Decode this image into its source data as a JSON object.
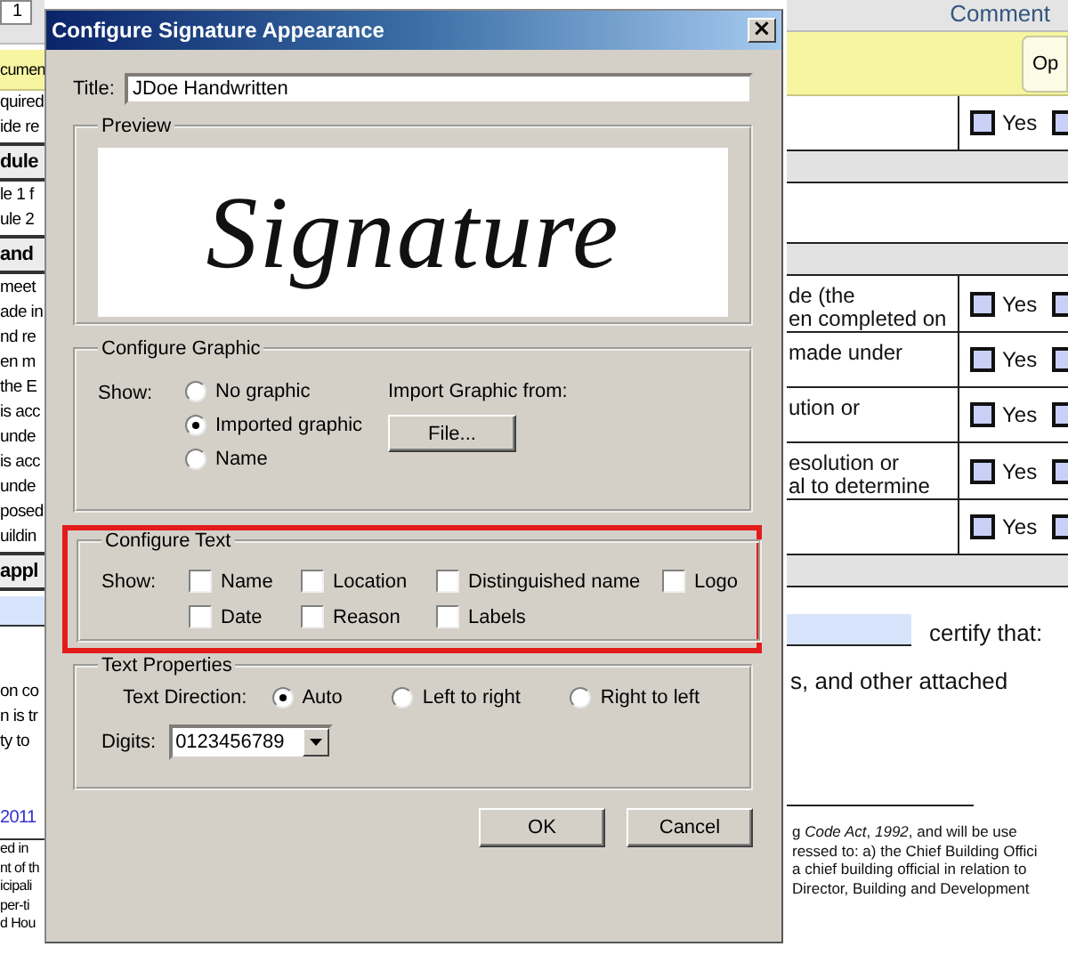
{
  "document": {
    "page_number": "1",
    "comment_tab": "Comment",
    "banner_text": "cumen",
    "banner_button": "Op",
    "left_lines": [
      {
        "kind": "text",
        "text": "quired"
      },
      {
        "kind": "text",
        "text": "ide re"
      },
      {
        "kind": "heading",
        "text": "dule"
      },
      {
        "kind": "text",
        "text": "le 1 f"
      },
      {
        "kind": "text",
        "text": "ule 2"
      },
      {
        "kind": "heading",
        "text": "and"
      },
      {
        "kind": "text",
        "text": "meet"
      },
      {
        "kind": "text",
        "text": "ade in"
      },
      {
        "kind": "text",
        "text": "nd re"
      },
      {
        "kind": "text",
        "text": "en m"
      },
      {
        "kind": "text",
        "text": "the E"
      },
      {
        "kind": "text",
        "text": "is acc"
      },
      {
        "kind": "text",
        "text": "unde"
      },
      {
        "kind": "text",
        "text": "is acc"
      },
      {
        "kind": "text",
        "text": "unde"
      },
      {
        "kind": "text",
        "text": "posed"
      },
      {
        "kind": "text",
        "text": "uildin"
      },
      {
        "kind": "heading",
        "text": "appl"
      },
      {
        "kind": "field"
      },
      {
        "kind": "text",
        "text": "on co"
      },
      {
        "kind": "text",
        "text": "n is tr"
      },
      {
        "kind": "text",
        "text": "ty to"
      },
      {
        "kind": "link",
        "text": "2011"
      },
      {
        "kind": "small",
        "text": "ed in"
      },
      {
        "kind": "small",
        "text": "nt of th"
      },
      {
        "kind": "small",
        "text": "icipali"
      },
      {
        "kind": "small",
        "text": "per-ti"
      },
      {
        "kind": "small",
        "text": "d Hou"
      }
    ],
    "right_rows": [
      {
        "kind": "row",
        "lines": [],
        "options": [
          {
            "label": "Yes",
            "checked": false
          },
          {
            "checked": false
          }
        ]
      },
      {
        "kind": "band"
      },
      {
        "kind": "blank"
      },
      {
        "kind": "band"
      },
      {
        "kind": "row",
        "lines": [
          "de (the",
          "en completed on"
        ],
        "options": [
          {
            "label": "Yes",
            "checked": false
          },
          {
            "checked": false
          }
        ]
      },
      {
        "kind": "row",
        "lines": [
          "made under"
        ],
        "options": [
          {
            "label": "Yes",
            "checked": false
          },
          {
            "checked": false
          }
        ]
      },
      {
        "kind": "row",
        "lines": [
          "ution or"
        ],
        "options": [
          {
            "label": "Yes",
            "checked": false
          },
          {
            "checked": false
          }
        ]
      },
      {
        "kind": "row",
        "lines": [
          "esolution or",
          "al to determine"
        ],
        "options": [
          {
            "label": "Yes",
            "checked": false
          },
          {
            "checked": false
          }
        ]
      },
      {
        "kind": "row",
        "lines": [],
        "options": [
          {
            "label": "Yes",
            "checked": false
          },
          {
            "checked": false
          }
        ]
      },
      {
        "kind": "band"
      },
      {
        "kind": "field",
        "text": "certify that:"
      },
      {
        "kind": "text",
        "text": "s, and other attached"
      },
      {
        "kind": "rule"
      },
      {
        "kind": "footnote",
        "lines": [
          "g *Code Act*, *1992*, and will be use",
          "ressed to: a) the Chief Building Offici",
          "a chief building official in relation to",
          "Director, Building and Development"
        ]
      }
    ]
  },
  "dialog": {
    "title": "Configure Signature Appearance",
    "close": "×",
    "title_label": "Title:",
    "title_value": "JDoe Handwritten",
    "preview": {
      "legend": "Preview",
      "signature": "Signature"
    },
    "graphic": {
      "legend": "Configure Graphic",
      "show_label": "Show:",
      "options": [
        {
          "label": "No graphic",
          "selected": false
        },
        {
          "label": "Imported graphic",
          "selected": true
        },
        {
          "label": "Name",
          "selected": false
        }
      ],
      "import_label": "Import Graphic from:",
      "file_button": "File..."
    },
    "text": {
      "highlighted": true,
      "legend": "Configure Text",
      "show_label": "Show:",
      "options": [
        {
          "label": "Name",
          "checked": false
        },
        {
          "label": "Location",
          "checked": false
        },
        {
          "label": "Distinguished name",
          "checked": false
        },
        {
          "label": "Logo",
          "checked": false
        },
        {
          "label": "Date",
          "checked": false
        },
        {
          "label": "Reason",
          "checked": false
        },
        {
          "label": "Labels",
          "checked": false
        }
      ]
    },
    "properties": {
      "legend": "Text Properties",
      "direction_label": "Text Direction:",
      "directions": [
        {
          "label": "Auto",
          "selected": true
        },
        {
          "label": "Left to right",
          "selected": false
        },
        {
          "label": "Right to left",
          "selected": false
        }
      ],
      "digits_label": "Digits:",
      "digits_value": "0123456789"
    },
    "buttons": [
      "OK",
      "Cancel"
    ]
  }
}
